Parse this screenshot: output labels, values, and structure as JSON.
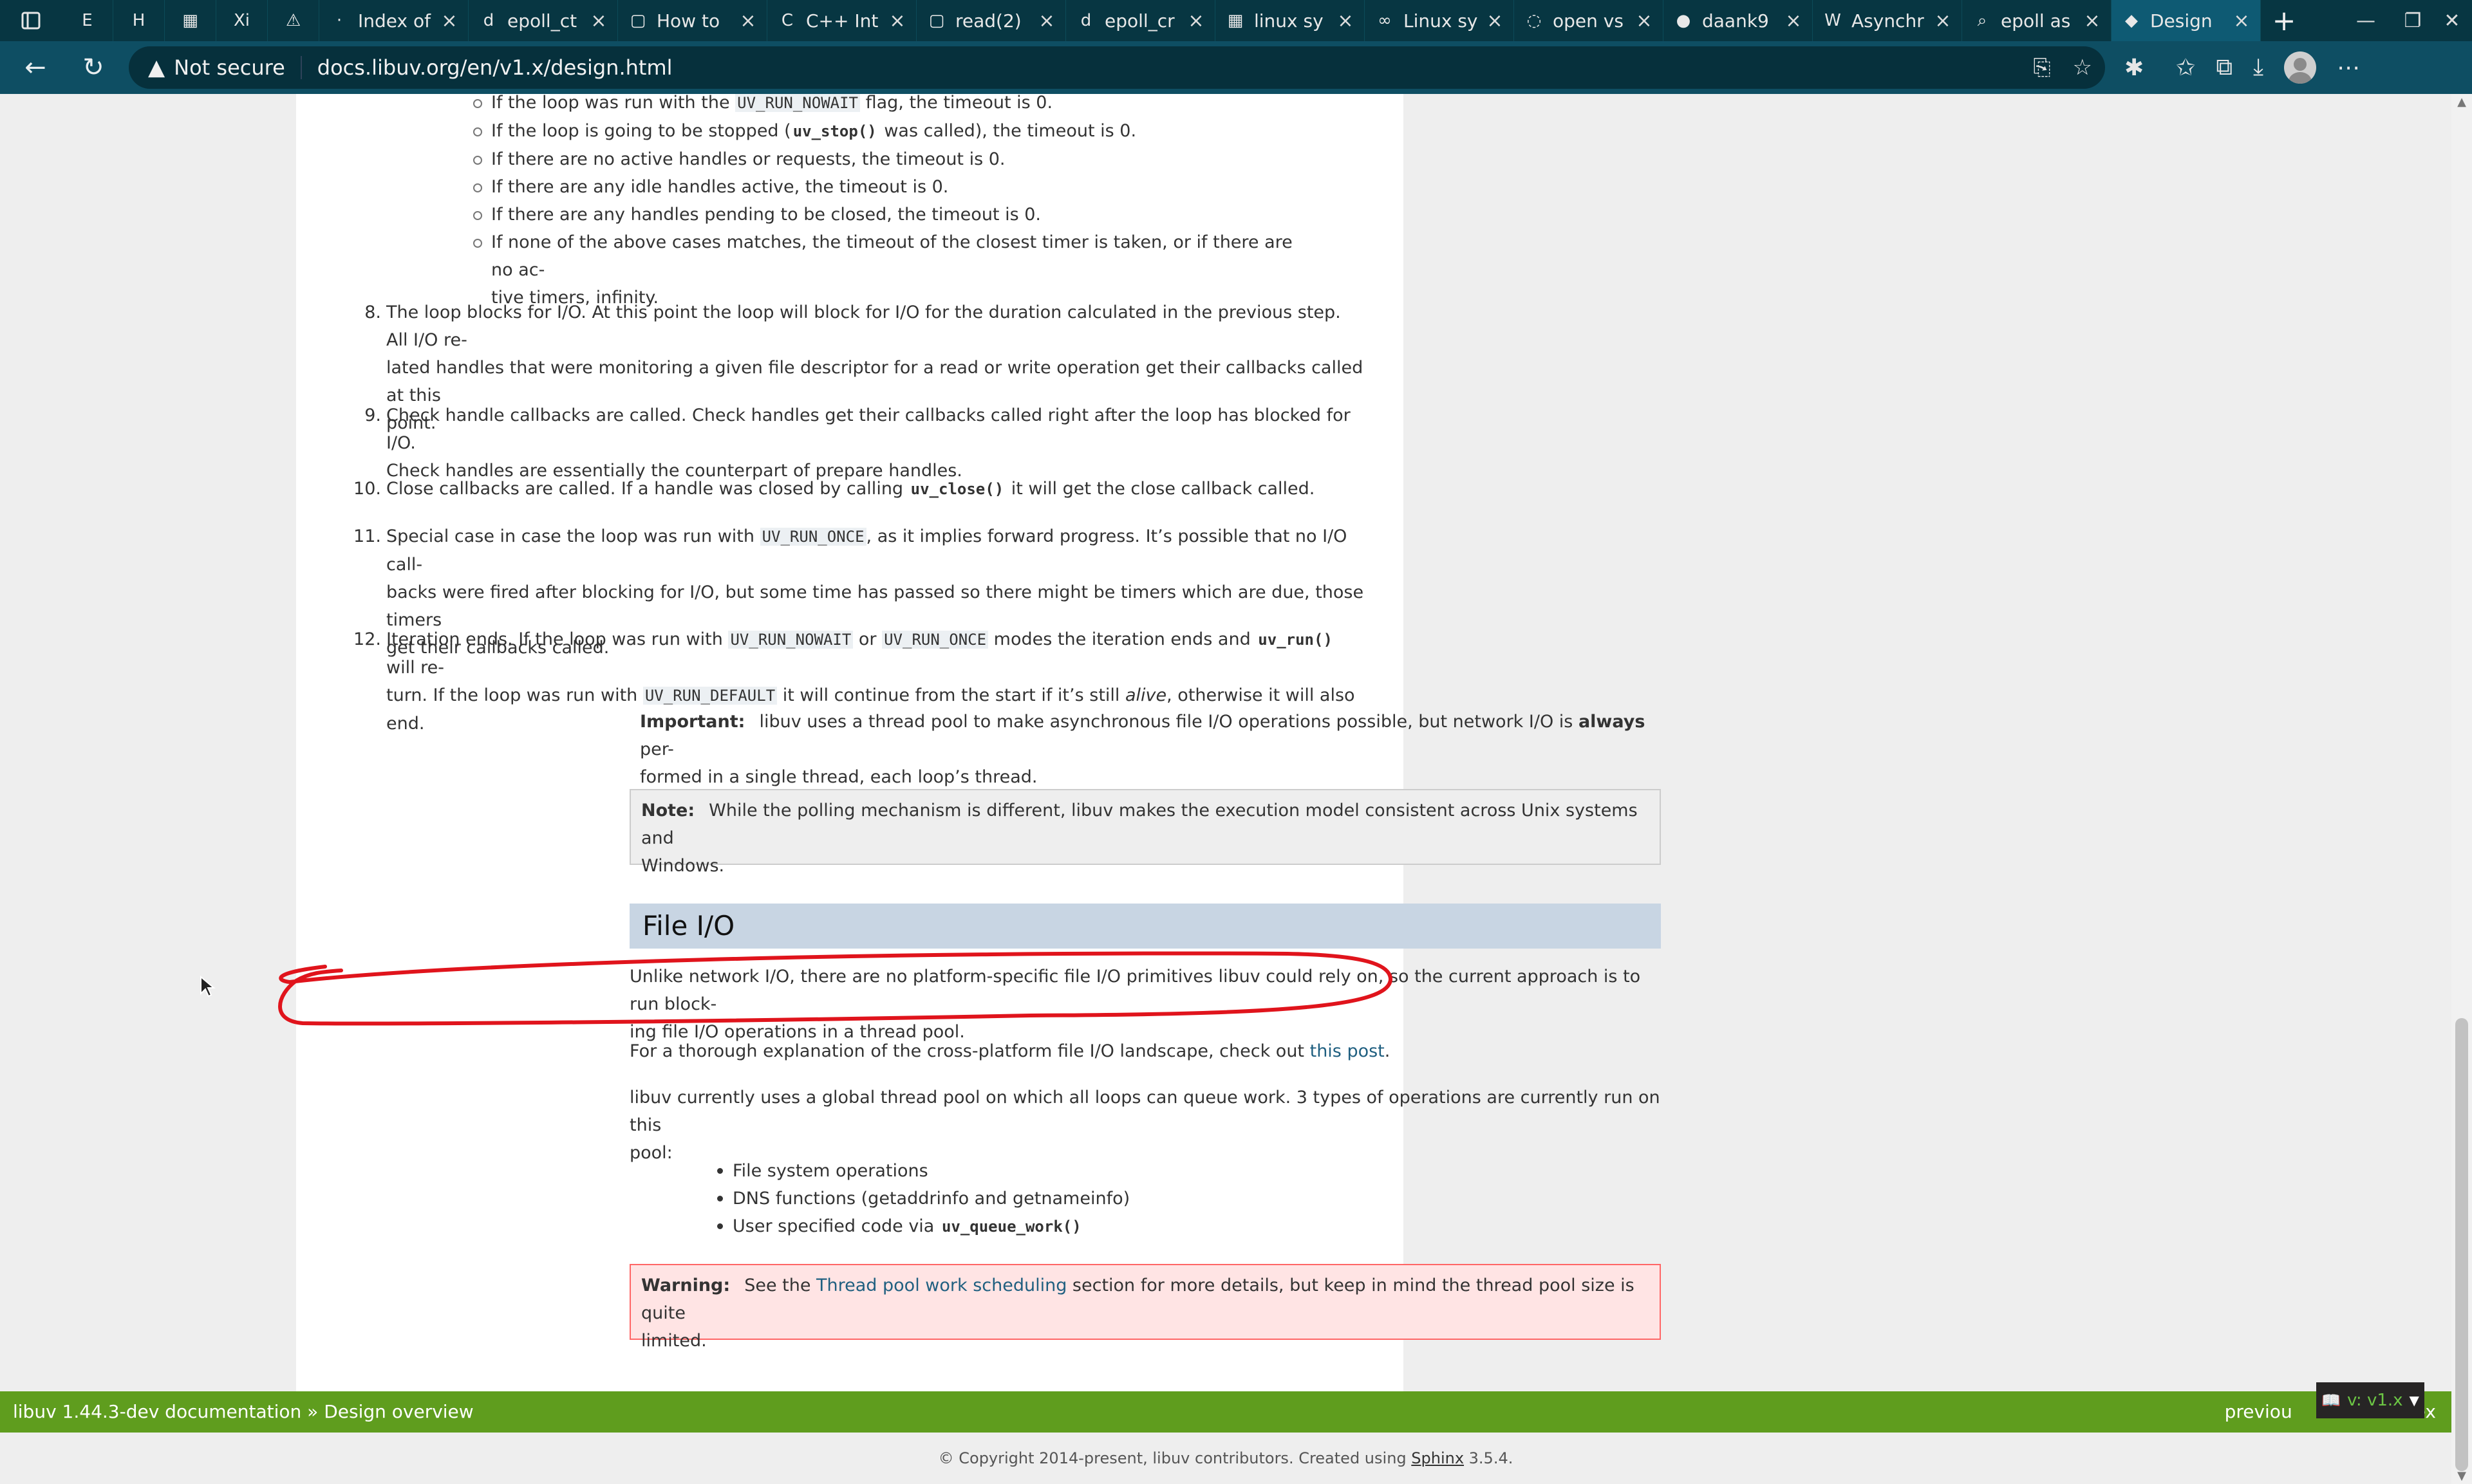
{
  "tabs": [
    {
      "icon": "E",
      "title": "",
      "type": "small"
    },
    {
      "icon": "H",
      "title": "",
      "type": "small"
    },
    {
      "icon": "▦",
      "title": "",
      "type": "small"
    },
    {
      "icon": "Xi",
      "title": "",
      "type": "small"
    },
    {
      "icon": "⚠",
      "title": "",
      "type": "small"
    },
    {
      "icon": "·",
      "title": "Index of",
      "type": "wide"
    },
    {
      "icon": "d",
      "title": "epoll_ct",
      "type": "wide"
    },
    {
      "icon": "▢",
      "title": "How to",
      "type": "wide"
    },
    {
      "icon": "C",
      "title": "C++ Int",
      "type": "wide"
    },
    {
      "icon": "▢",
      "title": "read(2)",
      "type": "wide"
    },
    {
      "icon": "d",
      "title": "epoll_cr",
      "type": "wide"
    },
    {
      "icon": "▦",
      "title": "linux sy",
      "type": "wide"
    },
    {
      "icon": "∞",
      "title": "Linux sy",
      "type": "wide"
    },
    {
      "icon": "◌",
      "title": "open vs",
      "type": "wide"
    },
    {
      "icon": "●",
      "title": "daank9",
      "type": "wide"
    },
    {
      "icon": "W",
      "title": "Asynchr",
      "type": "wide"
    },
    {
      "icon": "⌕",
      "title": "epoll as",
      "type": "wide"
    },
    {
      "icon": "◆",
      "title": "Design",
      "type": "wide",
      "active": true
    }
  ],
  "browser": {
    "security_text": "Not secure",
    "url": "docs.libuv.org/en/v1.x/design.html"
  },
  "doc": {
    "sub_bullets": [
      {
        "pre": "If the loop was run with the ",
        "code": "UV_RUN_NOWAIT",
        "post": " flag, the timeout is 0."
      },
      {
        "pre": "If the loop is going to be stopped (",
        "bcode": "uv_stop()",
        "post": " was called), the timeout is 0."
      },
      {
        "pre": "If there are no active handles or requests, the timeout is 0."
      },
      {
        "pre": "If there are any idle handles active, the timeout is 0."
      },
      {
        "pre": "If there are any handles pending to be closed, the timeout is 0."
      },
      {
        "pre": "If none of the above cases matches, the timeout of the closest timer is taken, or if there are no ac-"
      },
      {
        "pre": "tive timers, infinity.",
        "indent": true
      }
    ],
    "steps": {
      "s8": {
        "num": "8.",
        "line1": "The loop blocks for I/O. At this point the loop will block for I/O for the duration calculated in the previous step. All I/O re-",
        "line2": "lated handles that were monitoring a given file descriptor for a read or write operation get their callbacks called at this",
        "line3": "point."
      },
      "s9": {
        "num": "9.",
        "line1": "Check handle callbacks are called. Check handles get their callbacks called right after the loop has blocked for I/O.",
        "line2": "Check handles are essentially the counterpart of prepare handles."
      },
      "s10": {
        "num": "10.",
        "pre": "Close callbacks are called. If a handle was closed by calling ",
        "bcode": "uv_close()",
        "post": " it will get the close callback called."
      },
      "s11": {
        "num": "11.",
        "pre": "Special case in case the loop was run with ",
        "code": "UV_RUN_ONCE",
        "post": ", as it implies forward progress. It’s possible that no I/O call-",
        "line2": "backs were fired after blocking for I/O, but some time has passed so there might be timers which are due, those timers",
        "line3": "get their callbacks called."
      },
      "s12": {
        "num": "12.",
        "a": "Iteration ends. If the loop was run with ",
        "c1": "UV_RUN_NOWAIT",
        "b": " or ",
        "c2": "UV_RUN_ONCE",
        "c": " modes the iteration ends and ",
        "bc": "uv_run()",
        "d": " will re-",
        "l2a": "turn. If the loop was run with ",
        "c3": "UV_RUN_DEFAULT",
        "l2b": " it will continue from the start if it’s still ",
        "em": "alive",
        "l2c": ", otherwise it will also end."
      }
    },
    "important": {
      "label": "Important:",
      "pre": "libuv uses a thread pool to make asynchronous file I/O operations possible, but network I/O is ",
      "strong": "always",
      "post": " per-",
      "line2": "formed in a single thread, each loop’s thread."
    },
    "note": {
      "label": "Note:",
      "line1": "While the polling mechanism is different, libuv makes the execution model consistent across Unix systems and",
      "line2": "Windows."
    },
    "file_io": {
      "heading": "File I/O",
      "p1_line1": "Unlike network I/O, there are no platform-specific file I/O primitives libuv could rely on, so the current approach is to run block-",
      "p1_line2": "ing file I/O operations in a thread pool.",
      "p2_pre": "For a thorough explanation of the cross-platform file I/O landscape, check out ",
      "p2_link": "this post",
      "p2_post": ".",
      "p3_line1": "libuv currently uses a global thread pool on which all loops can queue work. 3 types of operations are currently run on this",
      "p3_line2": "pool:",
      "bullets": [
        "File system operations",
        "DNS functions (getaddrinfo and getnameinfo)"
      ],
      "bullet3_pre": "User specified code via ",
      "bullet3_code": "uv_queue_work()",
      "warning_label": "Warning:",
      "warning_pre": "See the ",
      "warning_link": "Thread pool work scheduling",
      "warning_post": " section for more details, but keep in mind the thread pool size is quite",
      "warning_line2": "limited."
    }
  },
  "related": {
    "crumb_root": "libuv 1.44.3-dev documentation",
    "crumb_sep": " » ",
    "crumb_page": "Design overview",
    "prev": "previou",
    "next_tail": "ex"
  },
  "footer": {
    "pre": "© Copyright 2014-present, libuv contributors. Created using ",
    "link": "Sphinx",
    "post": " 3.5.4."
  },
  "version_badge": {
    "text": "v: v1.x"
  },
  "colors": {
    "tabstrip": "#073642",
    "toolbar": "#0e4e63",
    "related_bar": "#5f9d1e",
    "annotation_stroke": "#e0141c",
    "warning_bg": "#ffe4e4",
    "section_head_bg": "#c8d5e3"
  }
}
